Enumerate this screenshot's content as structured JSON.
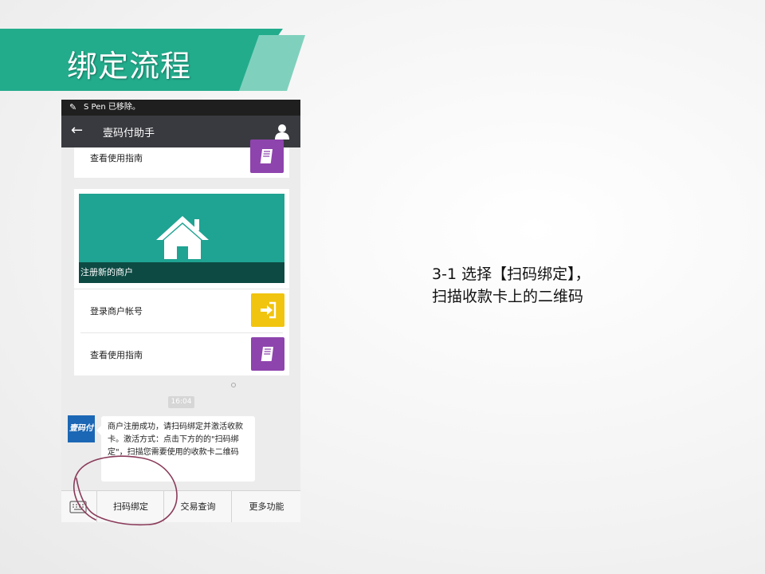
{
  "slide": {
    "title": "绑定流程",
    "description_line1": "3-1 选择【扫码绑定】，",
    "description_line2": "扫描收款卡上的二维码",
    "accent": "#22ac8c"
  },
  "phone": {
    "status_text": "S Pen 已移除。",
    "header_title": "壹码付助手",
    "guide_label_top": "查看使用指南",
    "banner_caption": "注册新的商户",
    "login_label": "登录商户帐号",
    "guide_label": "查看使用指南",
    "time": "16:04",
    "avatar_text": "壹码付",
    "message": "商户注册成功，请扫码绑定并激活收款卡。激活方式：点击下方的的\"扫码绑定\"，扫描您需要使用的收款卡二维码",
    "menu": [
      "扫码绑定",
      "交易查询",
      "更多功能"
    ],
    "colors": {
      "purple": "#8e44ad",
      "yellow": "#f1c40f",
      "teal": "#1fa392",
      "dark_teal": "#0d4a43"
    }
  }
}
